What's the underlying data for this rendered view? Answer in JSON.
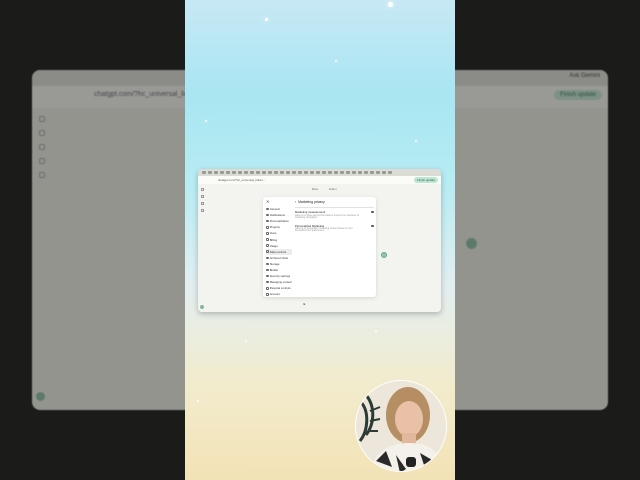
{
  "background_window": {
    "url": "chatgpt.com/?hc_universal_links=...",
    "ask_label": "Ask Gemini",
    "finish_update_label": "Finish update"
  },
  "browser": {
    "url": "chatgpt.com/?hc_universal_links=...",
    "finish_update_label": "Finish update",
    "toggle_tabs": [
      "Beta",
      "Editor"
    ]
  },
  "settings": {
    "nav_items": [
      "General",
      "Notifications",
      "Personalization",
      "Projects",
      "Voice",
      "Billing",
      "Usage",
      "Data controls",
      "Archived chats",
      "Storage",
      "Builder",
      "Security settings",
      "Managing content",
      "Parental controls",
      "Account"
    ],
    "active_index": 7,
    "panel_title": "Marketing privacy",
    "options": [
      {
        "title": "Marketing measurement",
        "description": "Allow us to share anonymized data to improve the relevance of marketing campaigns.",
        "enabled": true
      },
      {
        "title": "Personalized Marketing",
        "description": "Allow us to personalize marketing content based on your interactions and preferences.",
        "enabled": true
      }
    ]
  },
  "colors": {
    "gradient_top": "#a8e6f2",
    "gradient_bottom": "#f3e2b6",
    "accent_green": "#8ec9a8"
  }
}
